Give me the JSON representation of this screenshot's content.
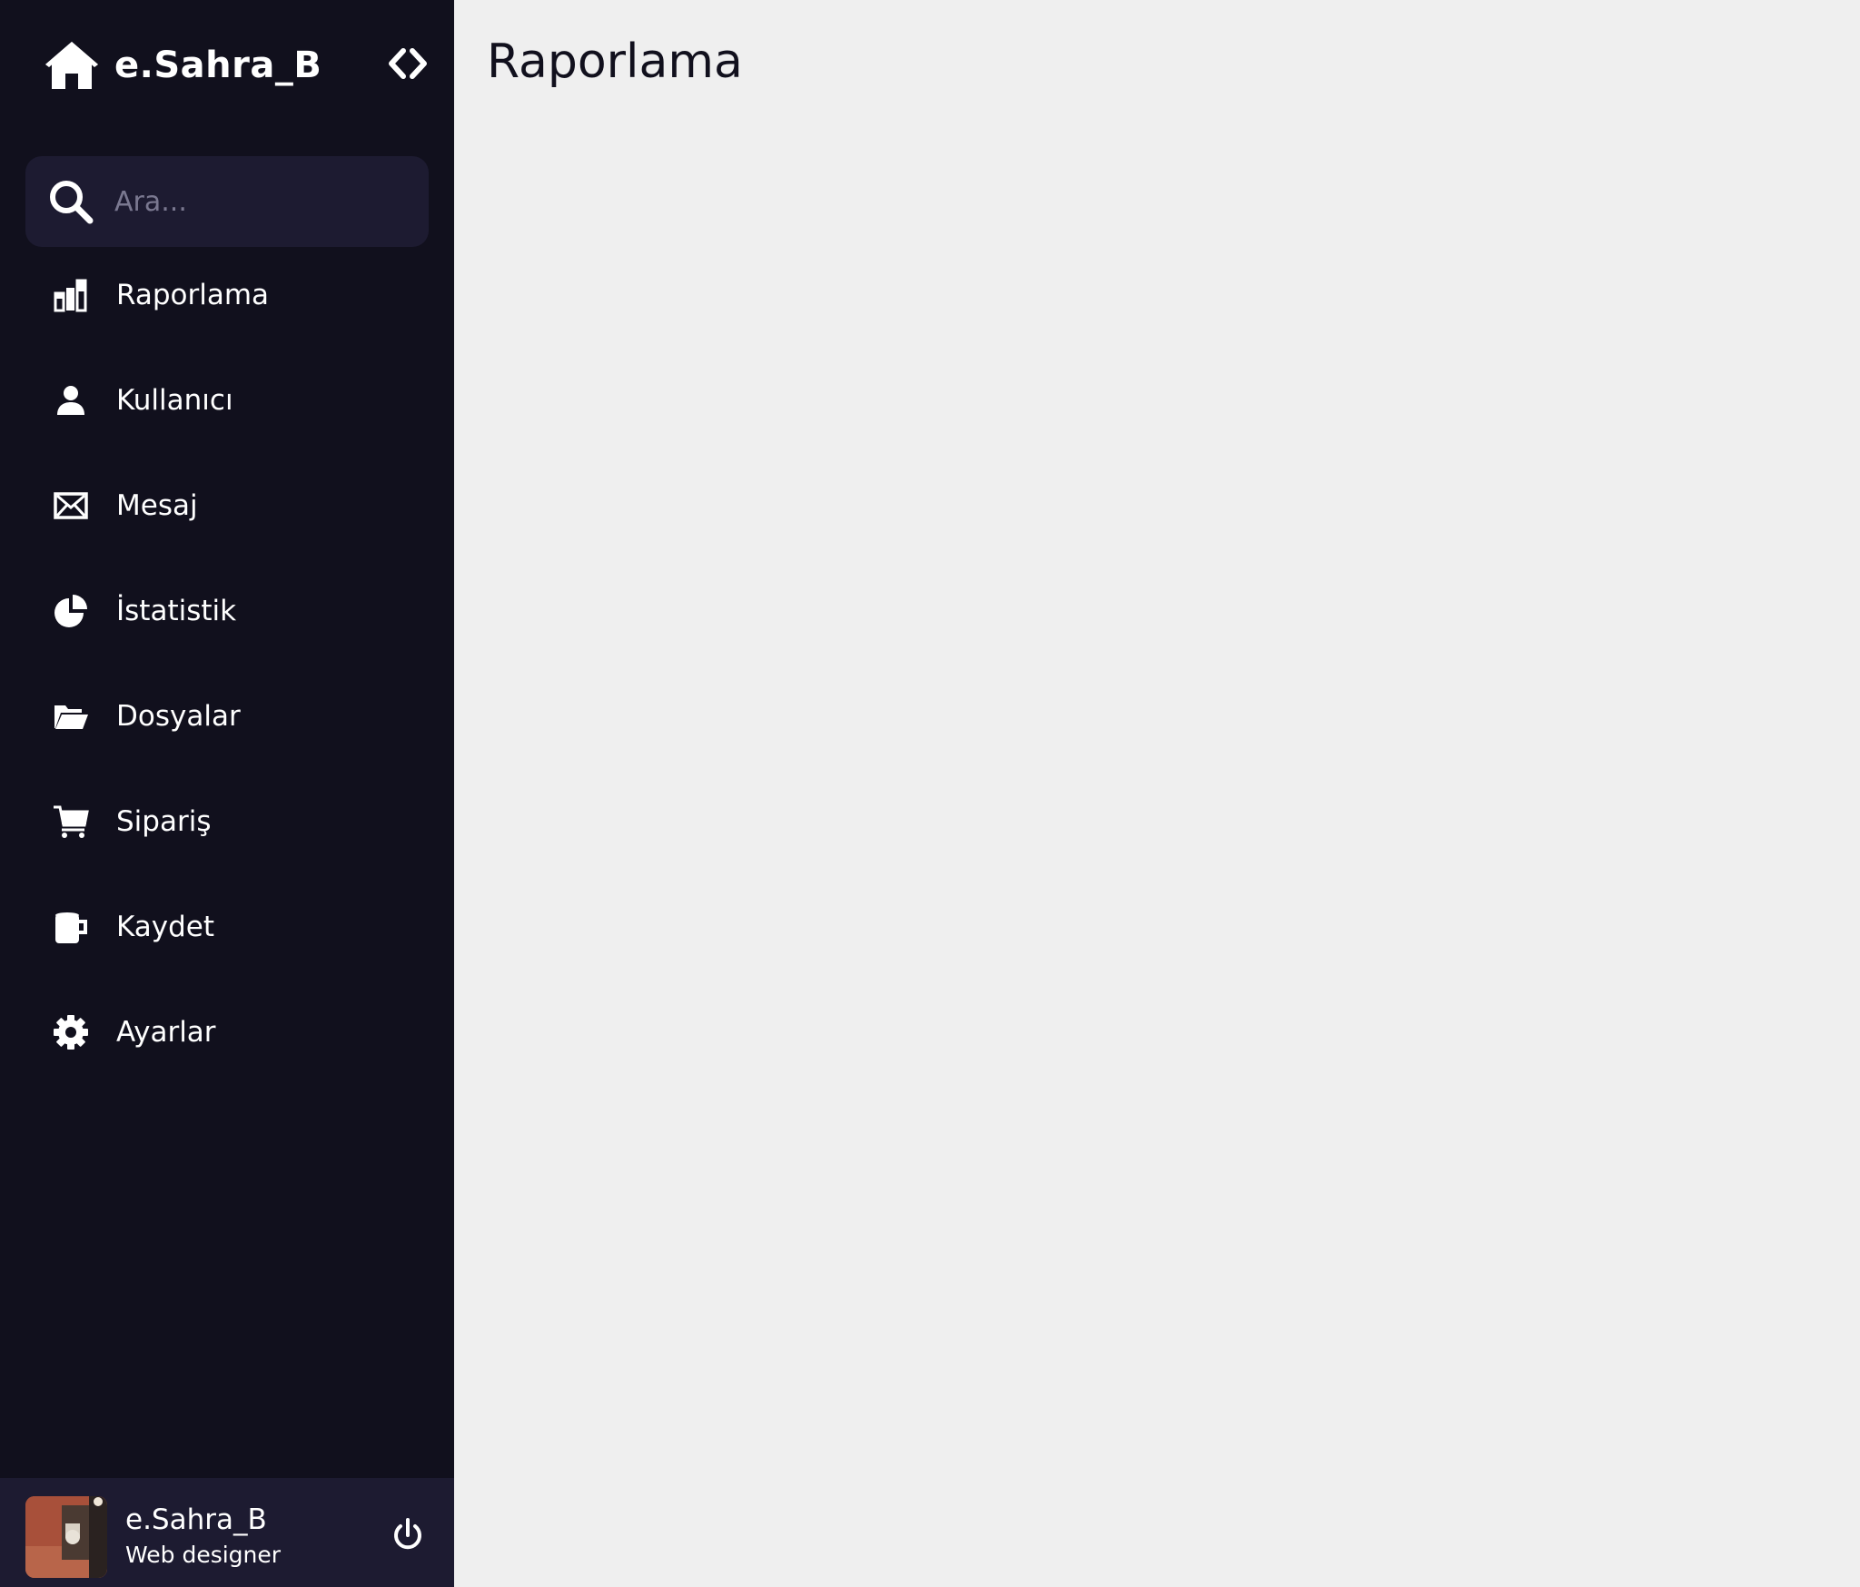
{
  "brand": {
    "name": "e.Sahra_B",
    "icon": "home-icon"
  },
  "toggle": {
    "icon": "code-arrows-icon"
  },
  "search": {
    "placeholder": "Ara...",
    "value": "",
    "icon": "search-icon"
  },
  "nav": {
    "items": [
      {
        "label": "Raporlama",
        "icon": "bar-chart-icon"
      },
      {
        "label": "Kullanıcı",
        "icon": "user-icon"
      },
      {
        "label": "Mesaj",
        "icon": "envelope-icon"
      },
      {
        "label": "İstatistik",
        "icon": "pie-chart-icon"
      },
      {
        "label": "Dosyalar",
        "icon": "folder-open-icon"
      },
      {
        "label": "Sipariş",
        "icon": "cart-icon"
      },
      {
        "label": "Kaydet",
        "icon": "mug-icon"
      },
      {
        "label": "Ayarlar",
        "icon": "gear-icon"
      }
    ]
  },
  "profile": {
    "name": "e.Sahra_B",
    "role": "Web designer",
    "logout_icon": "power-icon"
  },
  "main": {
    "title": "Raporlama"
  },
  "colors": {
    "sidebar_bg": "#11101d",
    "search_bg": "#1d1b31",
    "main_bg": "#efefef",
    "text_light": "#ffffff",
    "text_dark": "#11101d"
  }
}
